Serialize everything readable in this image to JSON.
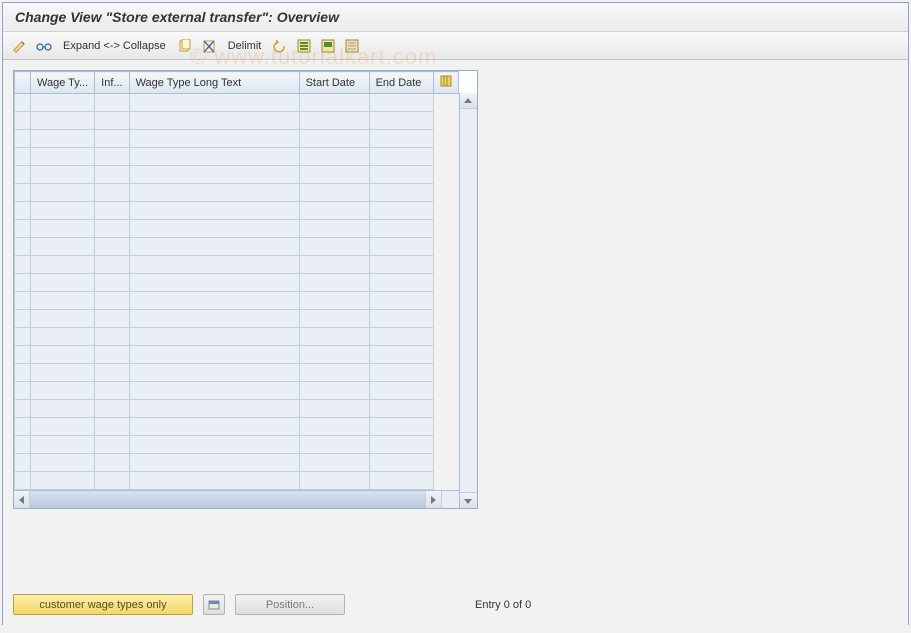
{
  "header": {
    "title": "Change View \"Store external transfer\": Overview"
  },
  "toolbar": {
    "expand_collapse": "Expand <-> Collapse",
    "delimit": "Delimit"
  },
  "grid": {
    "columns": {
      "wage_type": "Wage Ty...",
      "inf": "Inf...",
      "wage_long": "Wage Type Long Text",
      "start_date": "Start Date",
      "end_date": "End Date"
    },
    "row_count": 22
  },
  "footer": {
    "customer_btn": "customer wage types only",
    "position_btn": "Position...",
    "entry_text": "Entry 0 of 0"
  },
  "watermark": "© www.tutorialkart.com"
}
